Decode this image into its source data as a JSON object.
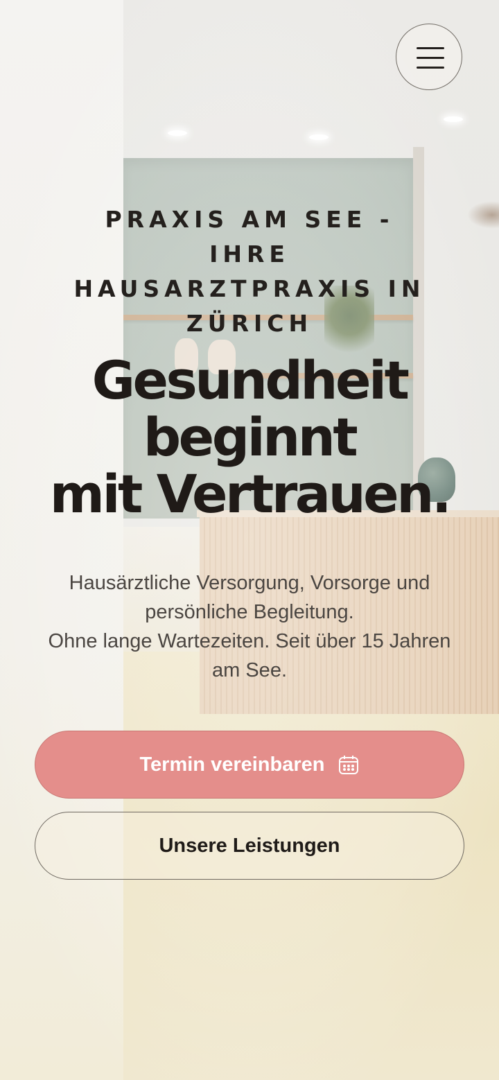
{
  "header": {
    "menu_icon": "hamburger-menu-icon"
  },
  "hero": {
    "eyebrow": "PRAXIS AM SEE - IHRE HAUSARZTPRAXIS IN ZÜRICH",
    "eyebrow_lines": [
      "PRAXIS AM SEE - IHRE",
      "HAUSARZTPRAXIS IN",
      "ZÜRICH"
    ],
    "headline_lines": [
      "Gesundheit",
      "beginnt",
      "mit Vertrauen."
    ],
    "subtext_lines": [
      "Hausärztliche Versorgung, Vorsorge und",
      "persönliche Begleitung.",
      "Ohne lange Wartezeiten. Seit über 15 Jahren",
      "am See."
    ]
  },
  "actions": {
    "primary_label": "Termin vereinbaren",
    "primary_icon": "calendar-icon",
    "secondary_label": "Unsere Leistungen"
  },
  "colors": {
    "primary_button": "#e48e8b",
    "text_dark": "#221d1a",
    "text_muted": "#4a4541"
  }
}
